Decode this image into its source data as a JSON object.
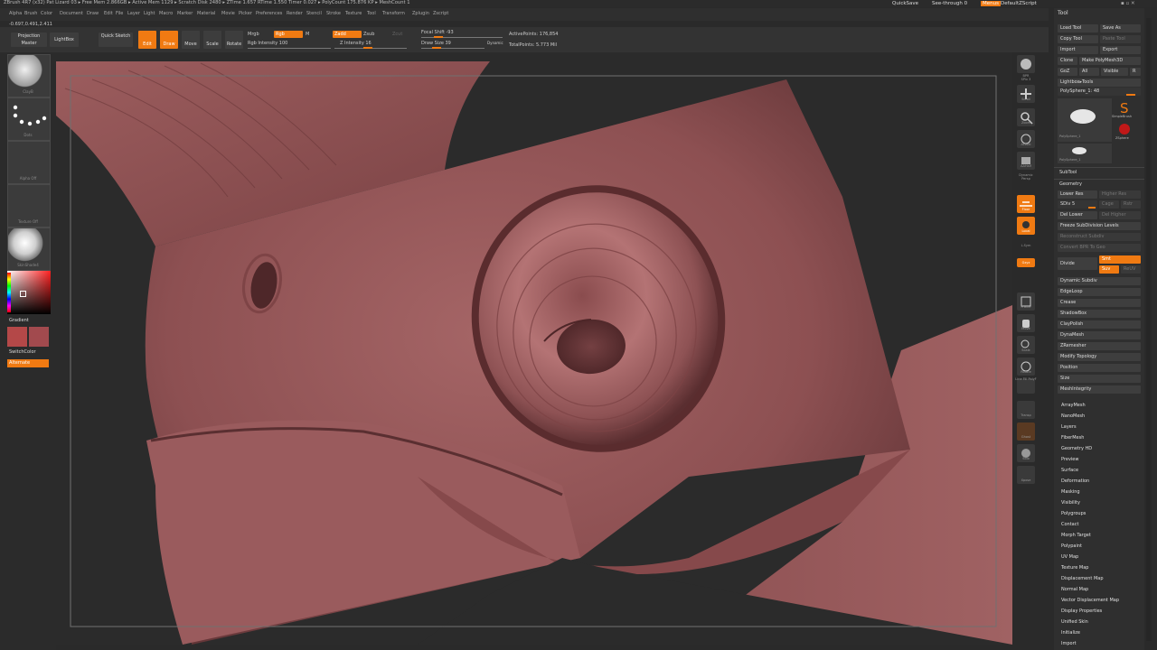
{
  "title_bar": {
    "text": "ZBrush 4R7 (x32)    Pat Lizard 03    ▸ Free Mem 2.866GB ▸ Active Mem 1129 ▸ Scratch Disk 2480 ▸ ZTime 1.657 RTime 1.550 Timer 0.027 ▸ PolyCount 175.876 KP ▸ MeshCount 1",
    "quicksave": "QuickSave",
    "seethrough": "See-through  0",
    "menus_btn": "Menus",
    "defaultscript": "DefaultZScript"
  },
  "menu": [
    "Alpha",
    "Brush",
    "Color",
    "Document",
    "Draw",
    "Edit",
    "File",
    "Layer",
    "Light",
    "Macro",
    "Marker",
    "Material",
    "Movie",
    "Picker",
    "Preferences",
    "Render",
    "Stencil",
    "Stroke",
    "Texture",
    "Tool",
    "Transform",
    "Zplugin",
    "Zscript"
  ],
  "coords": "-0.697,0.491,2.411",
  "toolbar": {
    "projection_master": "Projection Master",
    "lightbox": "LightBox",
    "quick_sketch": "Quick Sketch",
    "edit": "Edit",
    "draw": "Draw",
    "move": "Move",
    "scale": "Scale",
    "rotate": "Rotate",
    "mrgb": "Mrgb",
    "rgb": "Rgb",
    "m": "M",
    "rgb_intensity": "Rgb Intensity 100",
    "zadd": "Zadd",
    "zsub": "Zsub",
    "zcut": "Zcut",
    "z_intensity": "Z Intensity 16",
    "focal_shift": "Focal Shift -93",
    "draw_size": "Draw Size 39",
    "dynamic": "Dynamic",
    "active_points": "ActivePoints: 176,854",
    "total_points": "TotalPoints: 5.773 Mil"
  },
  "left_shelf": {
    "brush_cap": "ClayB",
    "stroke_cap": "Dots",
    "alpha_cap": "Alpha Off",
    "texture_cap": "Texture Off",
    "material_cap": "SkinShade4",
    "gradient": "Gradient",
    "switch_color": "SwitchColor",
    "alternate": "Alternate",
    "colors": {
      "main": "#b03a3a",
      "secondary": "#c05454",
      "swatch_a": "#b44848",
      "swatch_b": "#a24a4e"
    }
  },
  "right_shelf": [
    "BPR",
    "SPix 3",
    "Scroll",
    "Zoom",
    "Actual",
    "AAHalf",
    "Dynamic Persp",
    "Floor",
    "Local",
    "L.Sym",
    "Gxyz",
    "Frame",
    "Move",
    "Scale",
    "Rotate",
    "Line Fill PolyF",
    "Transp",
    "Ghost",
    "Solo",
    "Xpose"
  ],
  "tool_panel": {
    "header": "Tool",
    "load_tool": "Load Tool",
    "save_as": "Save As",
    "copy_tool": "Copy Tool",
    "paste_tool": "Paste Tool",
    "import": "Import",
    "export": "Export",
    "clone": "Clone",
    "make_polymesh": "Make PolyMesh3D",
    "goz": "GoZ",
    "all": "All",
    "visible": "Visible",
    "r": "R",
    "lightbox_tools": "Lightbox▸Tools",
    "polysphere_slider": "PolySphere_1: 48",
    "thumb1": "PolySphere_1",
    "thumb2": "SimpleBrush",
    "thumb3": "ZSphere",
    "thumb4": "PolySphere_1",
    "subtool": "SubTool",
    "geometry": "Geometry",
    "lower_res": "Lower Res",
    "higher_res": "Higher Res",
    "sdiv": "SDiv 5",
    "cage": "Cage",
    "rstr": "Rstr",
    "del_lower": "Del Lower",
    "del_higher": "Del Higher",
    "freeze_subdiv": "Freeze SubDivision Levels",
    "reconstruct_subdiv": "Reconstruct Subdiv",
    "convert_bpr": "Convert BPR To Geo",
    "divide": "Divide",
    "smt": "Smt",
    "suv": "Suv",
    "reuv": "ReUV",
    "geometry_items": [
      "Dynamic Subdiv",
      "EdgeLoop",
      "Crease",
      "ShadowBox",
      "ClayPolish",
      "DynaMesh",
      "ZRemesher",
      "Modify Topology",
      "Position",
      "Size",
      "MeshIntegrity"
    ],
    "sections": [
      "ArrayMesh",
      "NanoMesh",
      "Layers",
      "FiberMesh",
      "Geometry HD",
      "Preview",
      "Surface",
      "Deformation",
      "Masking",
      "Visibility",
      "Polygroups",
      "Contact",
      "Morph Target",
      "Polypaint",
      "UV Map",
      "Texture Map",
      "Displacement Map",
      "Normal Map",
      "Vector Displacement Map",
      "Display Properties",
      "Unified Skin",
      "Initialize",
      "Import"
    ]
  }
}
